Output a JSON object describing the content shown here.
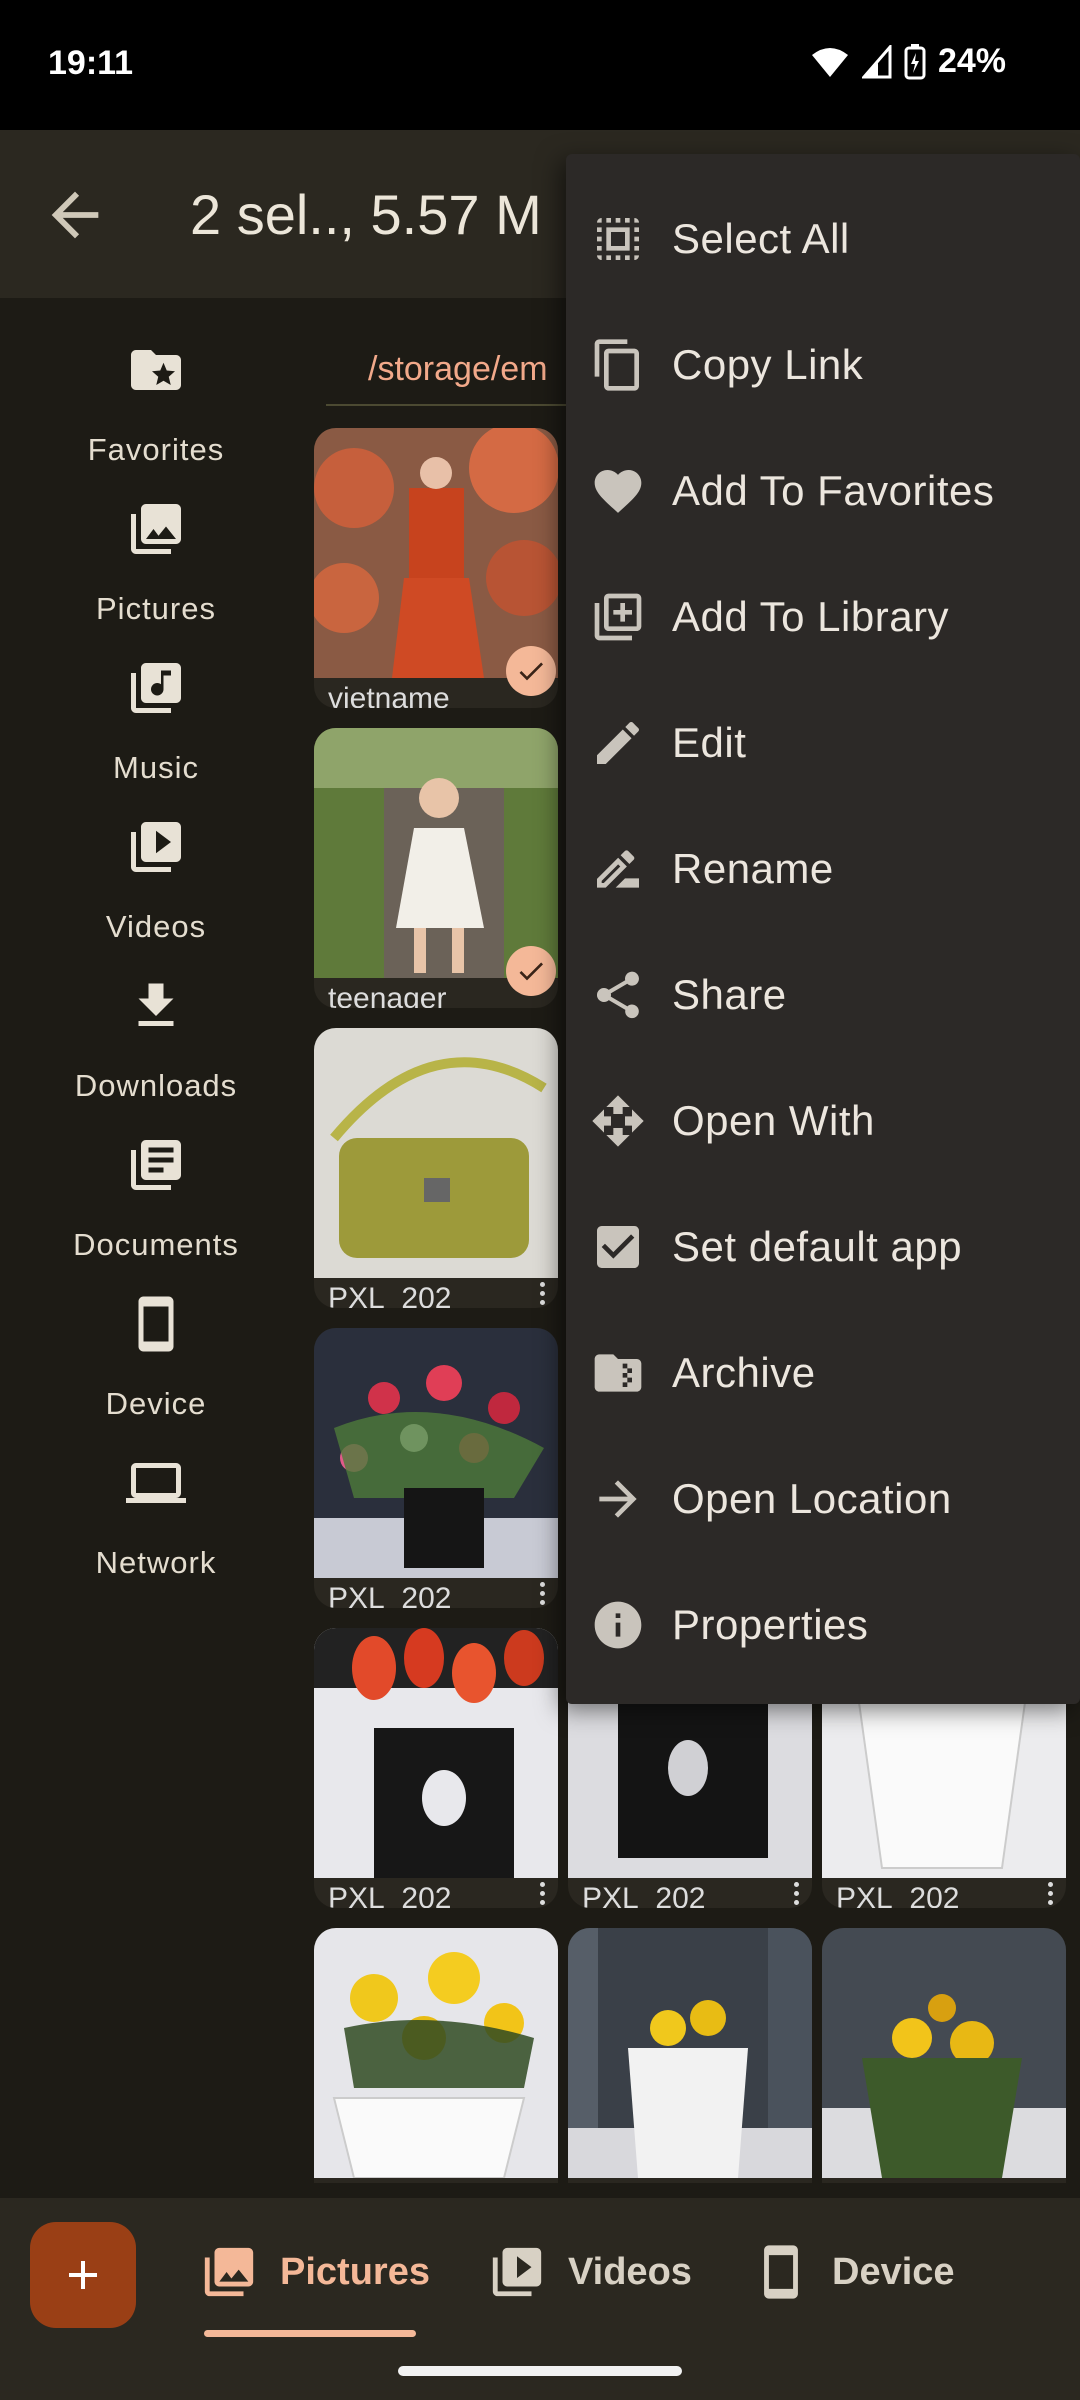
{
  "status": {
    "time": "19:11",
    "battery": "24%"
  },
  "app_bar": {
    "title": "2 sel.., 5.57 M"
  },
  "path": {
    "text": "/storage/em"
  },
  "rail": {
    "items": [
      {
        "label": "Favorites",
        "icon": "folder-star-icon"
      },
      {
        "label": "Pictures",
        "icon": "image-library-icon"
      },
      {
        "label": "Music",
        "icon": "music-library-icon"
      },
      {
        "label": "Videos",
        "icon": "video-library-icon"
      },
      {
        "label": "Downloads",
        "icon": "download-icon"
      },
      {
        "label": "Documents",
        "icon": "documents-icon"
      },
      {
        "label": "Device",
        "icon": "phone-icon"
      },
      {
        "label": "Network",
        "icon": "laptop-icon"
      }
    ]
  },
  "files": [
    {
      "name": "vietname",
      "selected": true
    },
    {
      "name": "teenager",
      "selected": true
    },
    {
      "name": "PXL_202",
      "selected": false
    },
    {
      "name": "PXL_202",
      "selected": false
    },
    {
      "name": "PXL_202",
      "selected": false
    },
    {
      "name": "PXL_202",
      "selected": false
    },
    {
      "name": "PXL_202",
      "selected": false
    },
    {
      "name": "",
      "selected": false
    },
    {
      "name": "",
      "selected": false
    },
    {
      "name": "",
      "selected": false
    }
  ],
  "menu": {
    "items": [
      {
        "label": "Select All",
        "icon": "select-all-icon"
      },
      {
        "label": "Copy Link",
        "icon": "copy-icon"
      },
      {
        "label": "Add To Favorites",
        "icon": "heart-icon"
      },
      {
        "label": "Add To Library",
        "icon": "library-add-icon"
      },
      {
        "label": "Edit",
        "icon": "pencil-icon"
      },
      {
        "label": "Rename",
        "icon": "rename-icon"
      },
      {
        "label": "Share",
        "icon": "share-icon"
      },
      {
        "label": "Open With",
        "icon": "open-with-icon"
      },
      {
        "label": "Set default app",
        "icon": "checkbox-icon"
      },
      {
        "label": "Archive",
        "icon": "archive-folder-icon"
      },
      {
        "label": "Open Location",
        "icon": "arrow-right-icon"
      },
      {
        "label": "Properties",
        "icon": "info-icon"
      }
    ]
  },
  "bottom_nav": {
    "tabs": [
      {
        "label": "Pictures",
        "active": true
      },
      {
        "label": "Videos",
        "active": false
      },
      {
        "label": "Device",
        "active": false
      }
    ],
    "active_color": "#f4b898",
    "fab_color": "#9a3f15"
  }
}
